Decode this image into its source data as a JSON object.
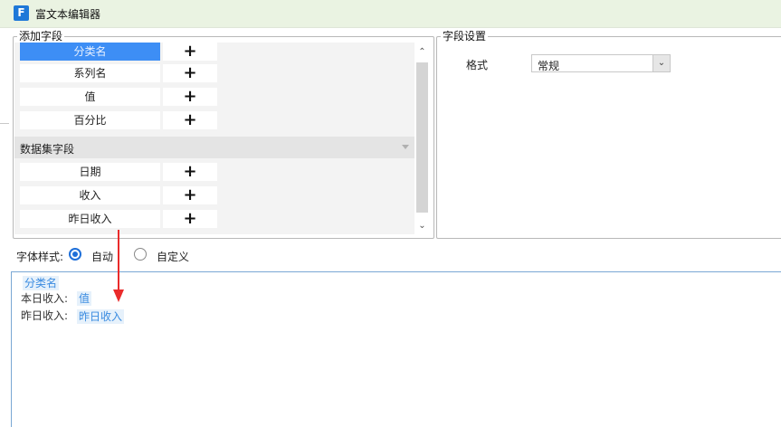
{
  "window": {
    "title": "富文本编辑器",
    "app_icon": "app-logo-icon"
  },
  "add_fields": {
    "legend": "添加字段",
    "fields": [
      {
        "name": "分类名",
        "selected": true
      },
      {
        "name": "系列名",
        "selected": false
      },
      {
        "name": "值",
        "selected": false
      },
      {
        "name": "百分比",
        "selected": false
      }
    ],
    "dataset_section": {
      "title": "数据集字段",
      "fields": [
        {
          "name": "日期"
        },
        {
          "name": "收入"
        },
        {
          "name": "昨日收入"
        }
      ]
    },
    "add_button_label": "+"
  },
  "field_settings": {
    "legend": "字段设置",
    "format_label": "格式",
    "format_value": "常规"
  },
  "font_style": {
    "label": "字体样式:",
    "options": [
      {
        "label": "自动",
        "checked": true
      },
      {
        "label": "自定义",
        "checked": false
      }
    ]
  },
  "editor": {
    "line1_chip": "分类名",
    "line2_text": "本日收入:",
    "line2_chip": "值",
    "line3_text": "昨日收入:",
    "line3_chip": "昨日收入"
  },
  "colors": {
    "accent": "#1e6fd9",
    "selected_field": "#3d8ef5",
    "chip_text": "#3a8be0",
    "chip_bg": "#e6f1fb",
    "annotation_arrow": "#ea2b2b",
    "titlebar": "#eaf3e2"
  }
}
